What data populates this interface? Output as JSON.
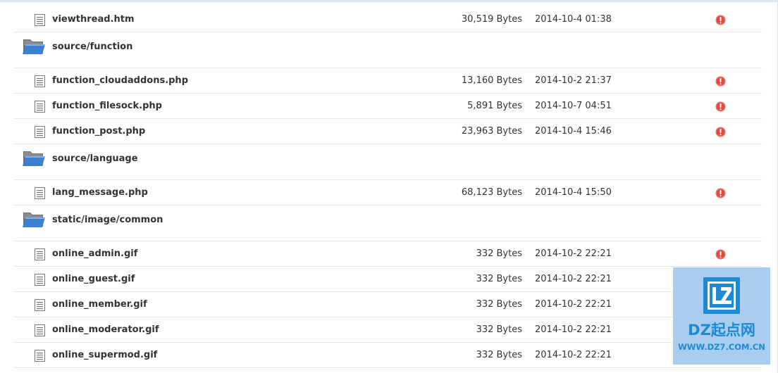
{
  "colors": {
    "warn_icon": "#e2493f",
    "folder_icon": "#3d7fcf",
    "row_border": "#e6eaee",
    "watermark_bg": "#a9cdee",
    "watermark_brand": "#1f8ad2"
  },
  "rows": [
    {
      "type": "file",
      "name": "viewthread.htm",
      "size": "30,519 Bytes",
      "date": "2014-10-4 01:38",
      "icon": "document-icon",
      "status_icon": "warning-icon"
    },
    {
      "type": "dir",
      "name": "source/function",
      "icon": "folder-icon"
    },
    {
      "type": "file",
      "name": "function_cloudaddons.php",
      "size": "13,160 Bytes",
      "date": "2014-10-2 21:37",
      "icon": "document-icon",
      "status_icon": "warning-icon"
    },
    {
      "type": "file",
      "name": "function_filesock.php",
      "size": "5,891 Bytes",
      "date": "2014-10-7 04:51",
      "icon": "document-icon",
      "status_icon": "warning-icon"
    },
    {
      "type": "file",
      "name": "function_post.php",
      "size": "23,963 Bytes",
      "date": "2014-10-4 15:46",
      "icon": "document-icon",
      "status_icon": "warning-icon"
    },
    {
      "type": "dir",
      "name": "source/language",
      "icon": "folder-icon"
    },
    {
      "type": "file",
      "name": "lang_message.php",
      "size": "68,123 Bytes",
      "date": "2014-10-4 15:50",
      "icon": "document-icon",
      "status_icon": "warning-icon"
    },
    {
      "type": "dir",
      "name": "static/image/common",
      "icon": "folder-icon"
    },
    {
      "type": "file",
      "name": "online_admin.gif",
      "size": "332 Bytes",
      "date": "2014-10-2 22:21",
      "icon": "document-icon",
      "status_icon": "warning-icon"
    },
    {
      "type": "file",
      "name": "online_guest.gif",
      "size": "332 Bytes",
      "date": "2014-10-2 22:21",
      "icon": "document-icon",
      "status_icon": "warning-icon"
    },
    {
      "type": "file",
      "name": "online_member.gif",
      "size": "332 Bytes",
      "date": "2014-10-2 22:21",
      "icon": "document-icon",
      "status_icon": "warning-icon"
    },
    {
      "type": "file",
      "name": "online_moderator.gif",
      "size": "332 Bytes",
      "date": "2014-10-2 22:21",
      "icon": "document-icon",
      "status_icon": "warning-icon"
    },
    {
      "type": "file",
      "name": "online_supermod.gif",
      "size": "332 Bytes",
      "date": "2014-10-2 22:21",
      "icon": "document-icon",
      "status_icon": "warning-icon"
    }
  ],
  "watermark": {
    "logo_text": "LZ",
    "name": "DZ起点网",
    "url": "WWW.DZ7.COM.CN"
  }
}
